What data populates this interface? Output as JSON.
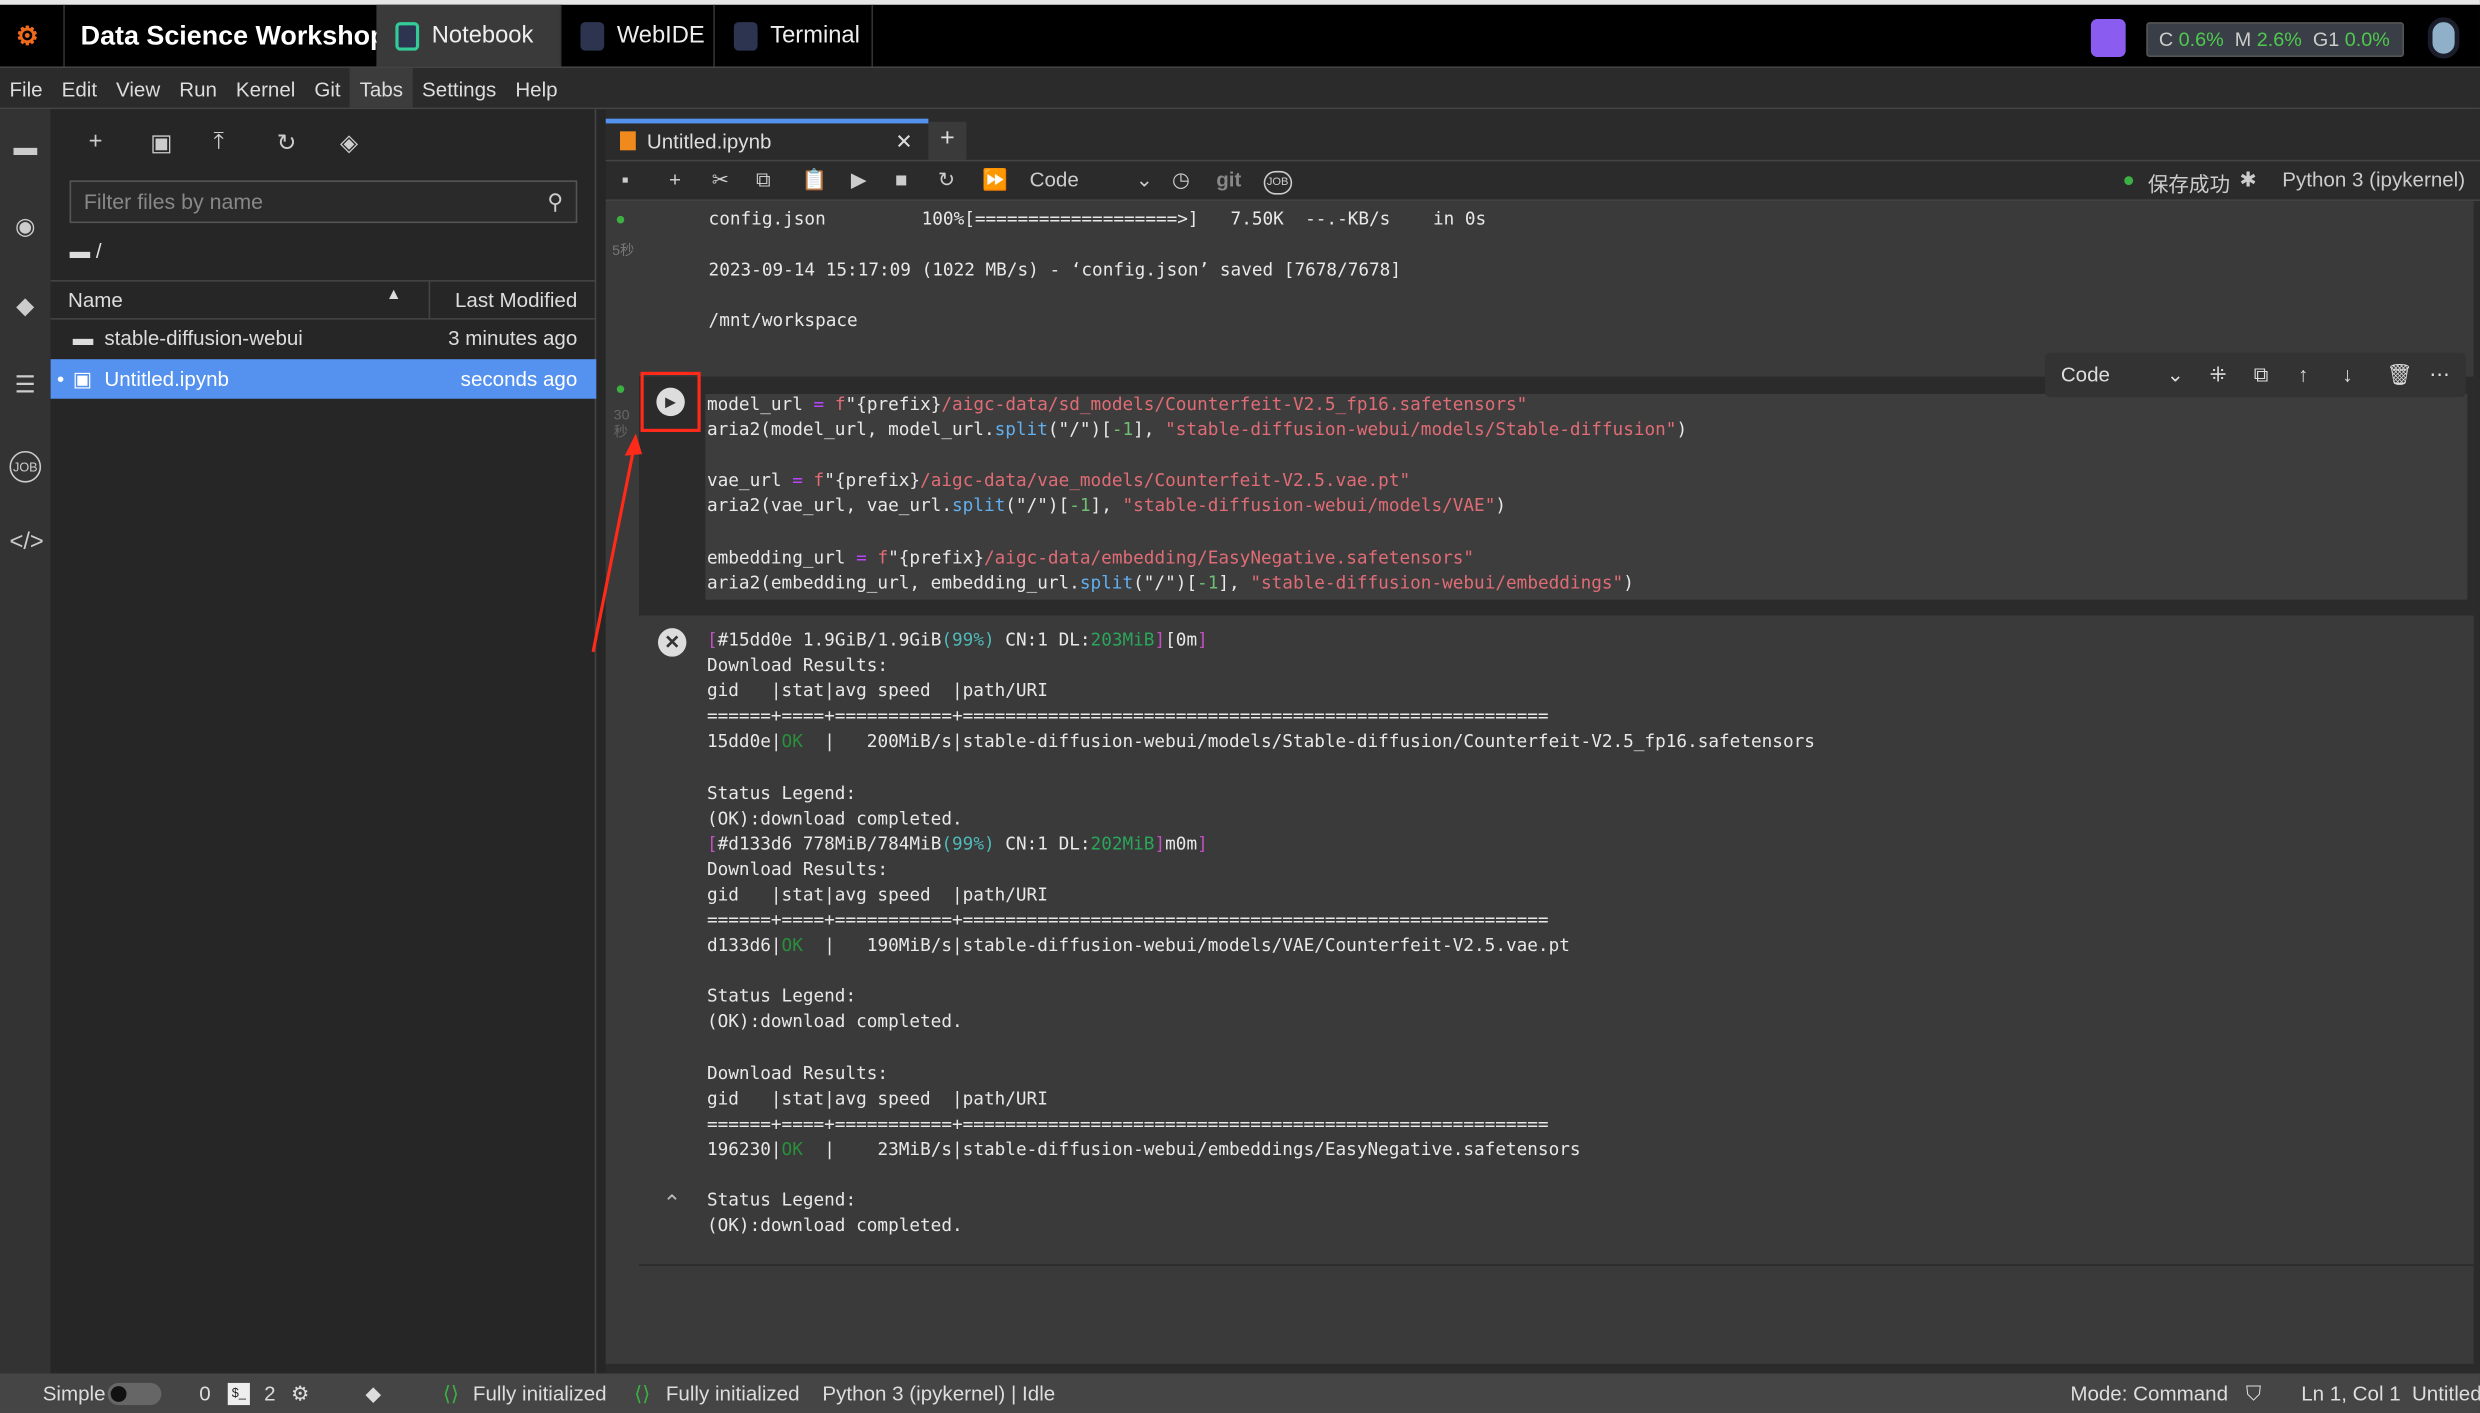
{
  "topbar": {
    "app_title": "Data Science Workshop",
    "tabs": [
      {
        "label": "Notebook",
        "icon": "notebook-icon"
      },
      {
        "label": "WebIDE",
        "icon": "code-icon"
      },
      {
        "label": "Terminal",
        "icon": "terminal-icon"
      }
    ],
    "resources": {
      "c_label": "C",
      "c_value": "0.6%",
      "m_label": "M",
      "m_value": "2.6%",
      "g_label": "G1",
      "g_value": "0.0%"
    }
  },
  "menu": [
    "File",
    "Edit",
    "View",
    "Run",
    "Kernel",
    "Git",
    "Tabs",
    "Settings",
    "Help"
  ],
  "filebrowser": {
    "filter_placeholder": "Filter files by name",
    "path": "/",
    "col_name": "Name",
    "col_modified": "Last Modified",
    "files": [
      {
        "name": "stable-diffusion-webui",
        "modified": "3 minutes ago",
        "type": "folder"
      },
      {
        "name": "Untitled.ipynb",
        "modified": "seconds ago",
        "type": "notebook"
      }
    ]
  },
  "notebook": {
    "tab_label": "Untitled.ipynb",
    "cell_type": "Code",
    "save_status": "保存成功",
    "kernel": "Python 3 (ipykernel)",
    "git_label": "git",
    "job_label": "JOB",
    "cell1_time": "5秒",
    "cell2_time": "30秒",
    "prev_output": [
      "config.json         100%[===================>]   7.50K  --.-KB/s    in 0s",
      "",
      "2023-09-14 15:17:09 (1022 MB/s) - ‘config.json’ saved [7678/7678]",
      "",
      "/mnt/workspace"
    ],
    "code": [
      [
        [
          "model_url ",
          ""
        ],
        [
          "=",
          " op"
        ],
        [
          " f",
          "str"
        ],
        [
          "\"{prefix}",
          ""
        ],
        [
          "/aigc-data/sd_models/Counterfeit-V2.5_fp16.safetensors\"",
          "str"
        ]
      ],
      [
        [
          "aria2(model_url, model_url.",
          ""
        ],
        [
          "split",
          "fn"
        ],
        [
          "(\"/\")[",
          ""
        ],
        [
          "-1",
          "num"
        ],
        [
          "], ",
          ""
        ],
        [
          "\"stable-diffusion-webui/models/Stable-diffusion\"",
          "str"
        ],
        [
          ")",
          ""
        ]
      ],
      [],
      [
        [
          "vae_url ",
          ""
        ],
        [
          "=",
          "op"
        ],
        [
          " f",
          "str"
        ],
        [
          "\"{prefix}",
          ""
        ],
        [
          "/aigc-data/vae_models/Counterfeit-V2.5.vae.pt\"",
          "str"
        ]
      ],
      [
        [
          "aria2(vae_url, vae_url.",
          ""
        ],
        [
          "split",
          "fn"
        ],
        [
          "(\"/\")[",
          ""
        ],
        [
          "-1",
          "num"
        ],
        [
          "], ",
          ""
        ],
        [
          "\"stable-diffusion-webui/models/VAE\"",
          "str"
        ],
        [
          ")",
          ""
        ]
      ],
      [],
      [
        [
          "embedding_url ",
          ""
        ],
        [
          "=",
          "op"
        ],
        [
          " f",
          "str"
        ],
        [
          "\"{prefix}",
          ""
        ],
        [
          "/aigc-data/embedding/EasyNegative.safetensors\"",
          "str"
        ]
      ],
      [
        [
          "aria2(embedding_url, embedding_url.",
          ""
        ],
        [
          "split",
          "fn"
        ],
        [
          "(\"/\")[",
          ""
        ],
        [
          "-1",
          "num"
        ],
        [
          "], ",
          ""
        ],
        [
          "\"stable-diffusion-webui/embeddings\"",
          "str"
        ],
        [
          ")",
          ""
        ]
      ]
    ],
    "output": [
      [
        [
          "[",
          "mag"
        ],
        [
          "#15dd0e 1.9GiB/1.9GiB",
          ""
        ],
        [
          "(99%)",
          "cy"
        ],
        [
          " CN:1 DL:",
          ""
        ],
        [
          "203MiB",
          "grn"
        ],
        [
          "]",
          "mag"
        ],
        [
          "[0m",
          ""
        ],
        [
          "]",
          "mag"
        ]
      ],
      [
        [
          "Download Results:",
          ""
        ]
      ],
      [
        [
          "gid   |stat|avg speed  |path/URI",
          ""
        ]
      ],
      [
        [
          "======+====+===========+=======================================================",
          ""
        ]
      ],
      [
        [
          "15dd0e|",
          ""
        ],
        [
          "OK",
          "ok"
        ],
        [
          "  |   200MiB/s|stable-diffusion-webui/models/Stable-diffusion/Counterfeit-V2.5_fp16.safetensors",
          ""
        ]
      ],
      [],
      [
        [
          "Status Legend:",
          ""
        ]
      ],
      [
        [
          "(OK):download completed.",
          ""
        ]
      ],
      [
        [
          "[",
          "mag"
        ],
        [
          "#d133d6 778MiB/784MiB",
          ""
        ],
        [
          "(99%)",
          "cy"
        ],
        [
          " CN:1 DL:",
          ""
        ],
        [
          "202MiB",
          "grn"
        ],
        [
          "]",
          "mag"
        ],
        [
          "m0m",
          ""
        ],
        [
          "]",
          "mag"
        ]
      ],
      [
        [
          "Download Results:",
          ""
        ]
      ],
      [
        [
          "gid   |stat|avg speed  |path/URI",
          ""
        ]
      ],
      [
        [
          "======+====+===========+=======================================================",
          ""
        ]
      ],
      [
        [
          "d133d6|",
          ""
        ],
        [
          "OK",
          "ok"
        ],
        [
          "  |   190MiB/s|stable-diffusion-webui/models/VAE/Counterfeit-V2.5.vae.pt",
          ""
        ]
      ],
      [],
      [
        [
          "Status Legend:",
          ""
        ]
      ],
      [
        [
          "(OK):download completed.",
          ""
        ]
      ],
      [],
      [
        [
          "Download Results:",
          ""
        ]
      ],
      [
        [
          "gid   |stat|avg speed  |path/URI",
          ""
        ]
      ],
      [
        [
          "======+====+===========+=======================================================",
          ""
        ]
      ],
      [
        [
          "196230|",
          ""
        ],
        [
          "OK",
          "ok"
        ],
        [
          "  |    23MiB/s|stable-diffusion-webui/embeddings/EasyNegative.safetensors",
          ""
        ]
      ],
      [],
      [
        [
          "Status Legend:",
          ""
        ]
      ],
      [
        [
          "(OK):download completed.",
          ""
        ]
      ]
    ]
  },
  "statusbar": {
    "mode_label": "Simple",
    "terminals": "0",
    "kernels": "2",
    "init1": "Fully initialized",
    "init2": "Fully initialized",
    "kernel_status": "Python 3 (ipykernel) | Idle",
    "mode": "Mode: Command",
    "position": "Ln 1, Col 1",
    "file": "Untitled.ipynb"
  },
  "colors": {
    "accent": "#5591ee",
    "annotation": "#ff2a1a",
    "ok": "#3cb043"
  }
}
